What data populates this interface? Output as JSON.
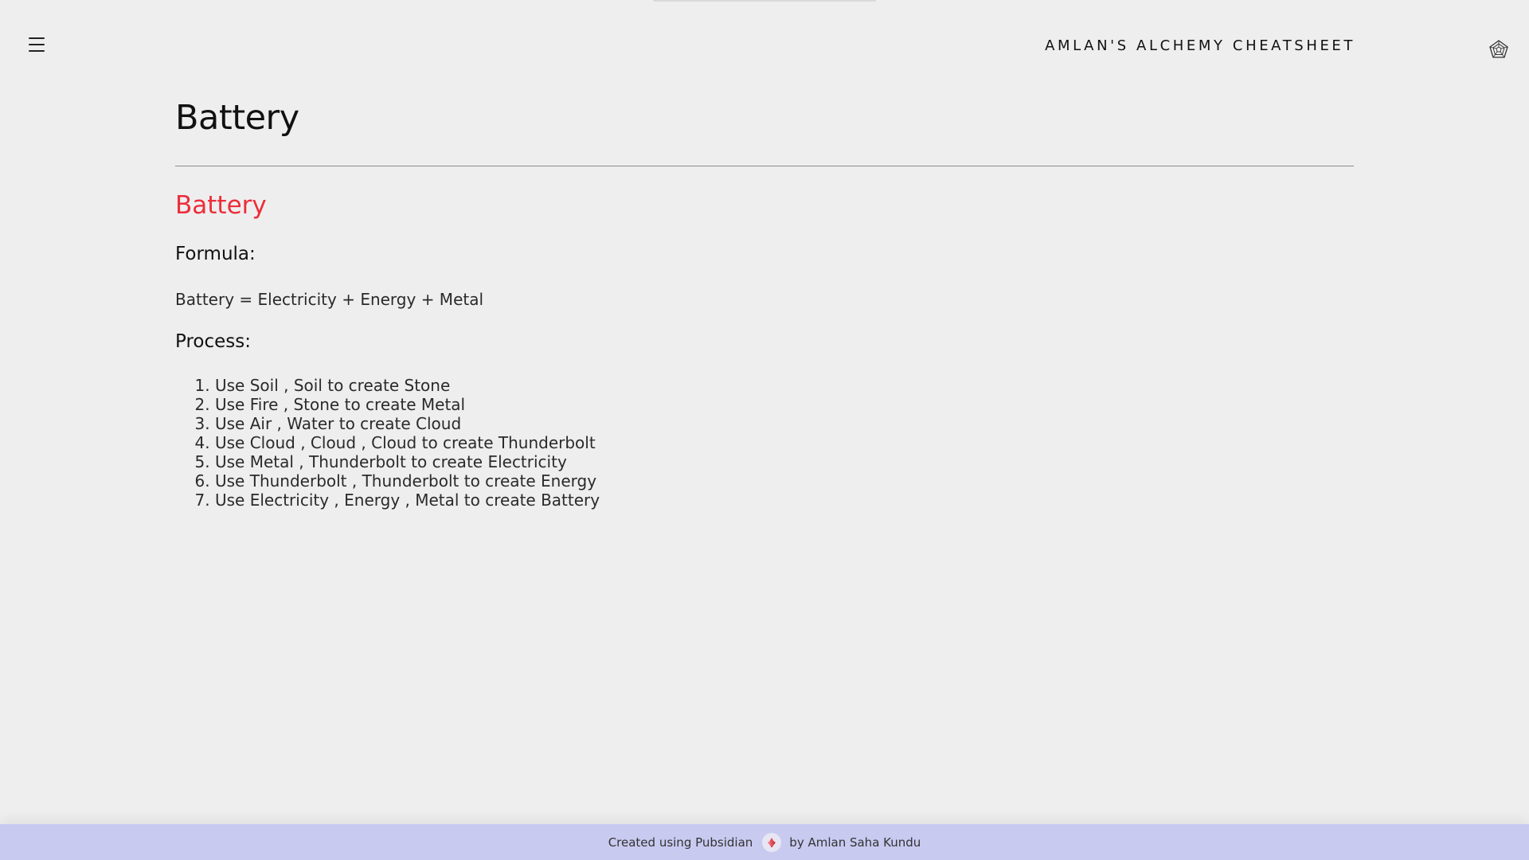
{
  "header": {
    "menu_icon": "hamburger-menu-icon",
    "site_title": "AMLAN'S ALCHEMY CHEATSHEET",
    "theme_icon": "pentagon-web-icon"
  },
  "page": {
    "title": "Battery",
    "section_title": "Battery",
    "formula_heading": "Formula:",
    "formula_text": "Battery = Electricity + Energy + Metal",
    "process_heading": "Process:",
    "steps": [
      "Use Soil , Soil to create Stone",
      "Use Fire , Stone to create Metal",
      "Use Air , Water to create Cloud",
      "Use Cloud , Cloud , Cloud to create Thunderbolt",
      "Use Metal , Thunderbolt to create Electricity",
      "Use Thunderbolt , Thunderbolt to create Energy",
      "Use Electricity , Energy , Metal to create Battery"
    ]
  },
  "footer": {
    "created_text": "Created using Pubsidian",
    "logo_icon": "pubsidian-logo-icon",
    "author_text": "by Amlan Saha Kundu",
    "background_color": "#c9caf0"
  },
  "colors": {
    "accent_red": "#ec2e3a",
    "page_background": "#eeeeef"
  }
}
